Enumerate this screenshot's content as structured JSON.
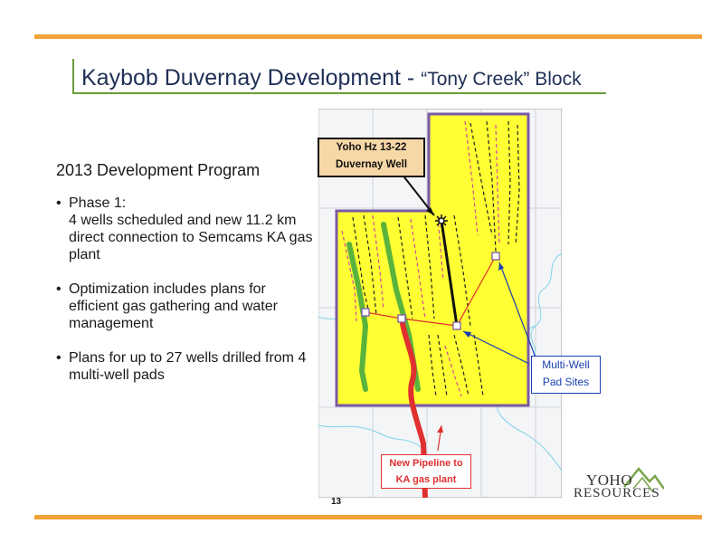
{
  "slide": {
    "title_main": "Kaybob Duvernay Development - ",
    "title_sub": "“Tony Creek” Block",
    "page_number": "13"
  },
  "body": {
    "heading": "2013 Development Program",
    "bullets": [
      "Phase 1:\n4 wells scheduled and new 11.2 km direct connection to Semcams KA gas plant",
      "Optimization includes plans for efficient gas gathering and water management",
      "Plans for up to 27 wells drilled from 4 multi-well pads"
    ]
  },
  "map": {
    "callouts": {
      "yoho_well": "Yoho Hz 13-22\nDuvernay Well",
      "multi_well": "Multi-Well\nPad Sites",
      "pipeline": "New Pipeline to\nKA gas plant"
    }
  },
  "logo": {
    "line1": "YOHO",
    "line2": "RESOURCES"
  },
  "colors": {
    "accent_orange": "#f2a23a",
    "accent_green": "#6d9b3a",
    "block_yellow": "#ffff33",
    "boundary_purple": "#7a5aa6",
    "pipeline_red": "#e03030"
  }
}
